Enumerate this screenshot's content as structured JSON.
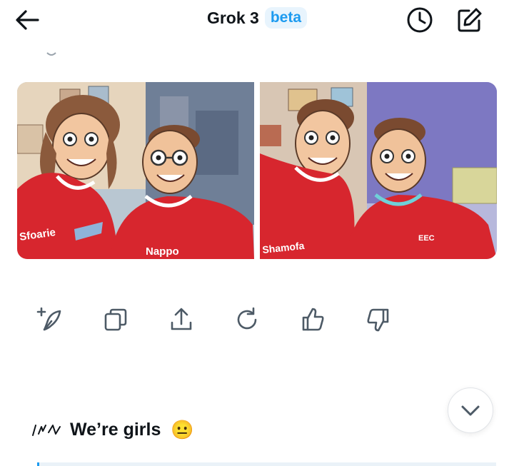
{
  "header": {
    "title": "Grok 3",
    "badge": "beta",
    "icons": {
      "back": "arrow-left-icon",
      "history": "clock-icon",
      "compose": "edit-square-icon"
    }
  },
  "images": [
    {
      "caption_left": "Sfoarie",
      "caption_right": "Nappo"
    },
    {
      "caption_left": "Shamofa",
      "caption_right": "EEC"
    }
  ],
  "actions": [
    {
      "name": "edit-image-button",
      "icon": "sparkle-brush-icon"
    },
    {
      "name": "copy-button",
      "icon": "copy-icon"
    },
    {
      "name": "share-button",
      "icon": "upload-icon"
    },
    {
      "name": "regenerate-button",
      "icon": "refresh-icon"
    },
    {
      "name": "like-button",
      "icon": "thumbs-up-icon"
    },
    {
      "name": "dislike-button",
      "icon": "thumbs-down-icon"
    }
  ],
  "message": {
    "text": "We’re girls",
    "emoji": "😐"
  },
  "colors": {
    "accent": "#1d9bf0",
    "text": "#0f1419",
    "shirt": "#d7262e"
  }
}
